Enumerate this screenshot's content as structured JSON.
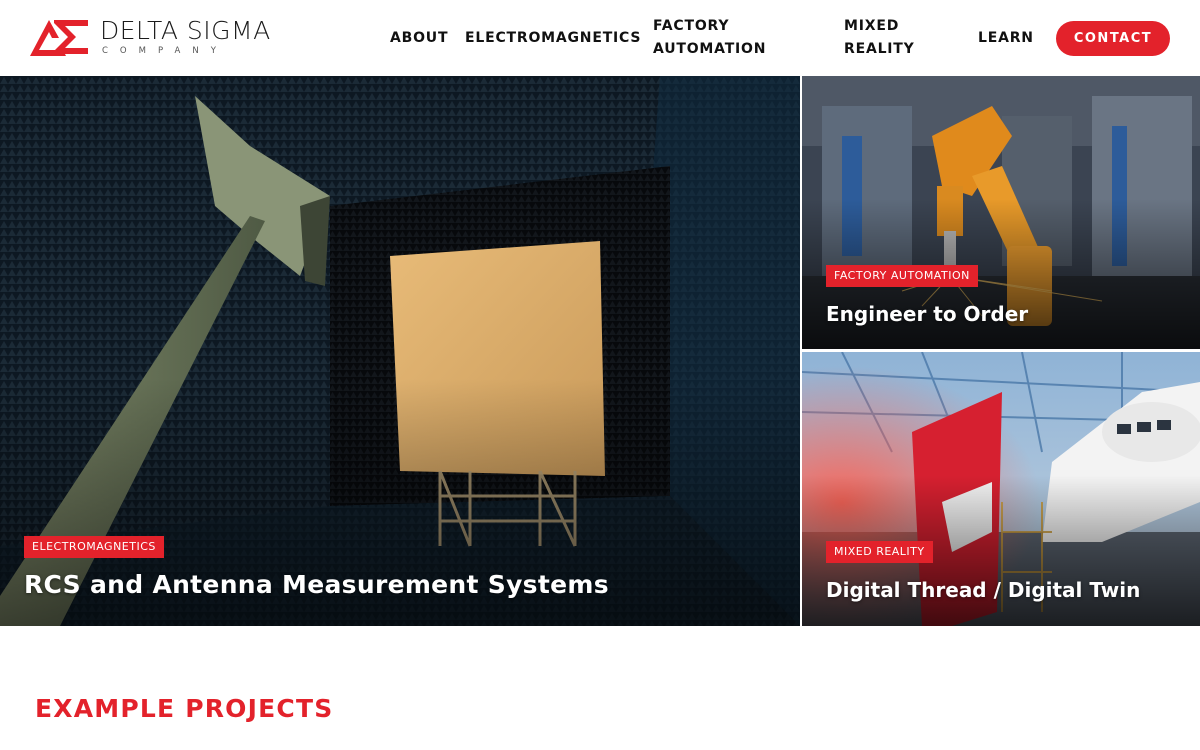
{
  "brand": {
    "name": "DELTA SIGMA",
    "subtitle": "COMPANY",
    "accent": "#e3222b"
  },
  "nav": {
    "items": [
      {
        "label": "ABOUT"
      },
      {
        "label": "ELECTROMAGNETICS"
      },
      {
        "label": "FACTORY AUTOMATION"
      },
      {
        "label": "MIXED REALITY"
      },
      {
        "label": "LEARN"
      }
    ],
    "contact_label": "CONTACT"
  },
  "hero": {
    "main": {
      "tag": "ELECTROMAGNETICS",
      "title": "RCS and Antenna Measurement Systems",
      "image_icon": "anechoic-chamber-photo"
    },
    "side_top": {
      "tag": "FACTORY AUTOMATION",
      "title": "Engineer to Order",
      "image_icon": "industrial-robot-photo"
    },
    "side_bottom": {
      "tag": "MIXED REALITY",
      "title": "Digital Thread / Digital Twin",
      "image_icon": "aircraft-hangar-photo"
    }
  },
  "sections": {
    "example_projects": "EXAMPLE PROJECTS"
  }
}
